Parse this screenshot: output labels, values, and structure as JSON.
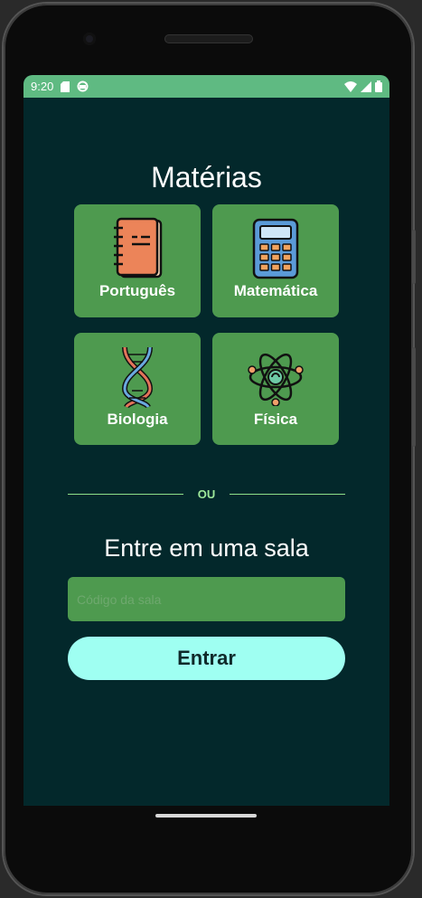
{
  "status_bar": {
    "time": "9:20",
    "icons": [
      "sd-card-icon",
      "sync-icon",
      "wifi-icon",
      "signal-icon",
      "battery-icon"
    ]
  },
  "main": {
    "title": "Matérias",
    "subjects": [
      {
        "label": "Português",
        "icon": "notebook-icon"
      },
      {
        "label": "Matemática",
        "icon": "calculator-icon"
      },
      {
        "label": "Biologia",
        "icon": "dna-icon"
      },
      {
        "label": "Física",
        "icon": "atom-icon"
      }
    ],
    "divider_text": "OU",
    "room_title": "Entre em uma sala",
    "code_placeholder": "Código da sala",
    "enter_label": "Entrar"
  },
  "colors": {
    "background": "#03282b",
    "status_bar": "#5fba82",
    "card": "#4e9a4f",
    "button": "#9ffff2"
  }
}
